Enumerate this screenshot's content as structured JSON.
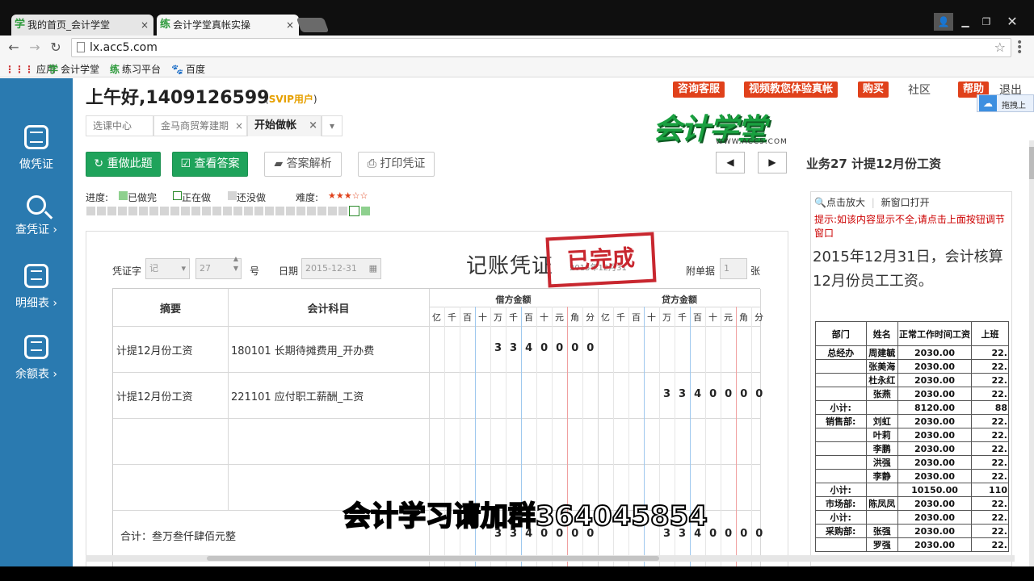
{
  "browser": {
    "tabs": [
      {
        "icon": "学",
        "label": "我的首页_会计学堂"
      },
      {
        "icon": "练",
        "label": "会计学堂真帐实操"
      }
    ],
    "close_glyph": "×",
    "url": "lx.acc5.com",
    "bookmarks": [
      {
        "icon": "⋮⋮⋮",
        "label": "应用"
      },
      {
        "icon": "学",
        "label": "会计学堂"
      },
      {
        "icon": "练",
        "label": "练习平台"
      },
      {
        "icon": "🐾",
        "label": "百度"
      }
    ]
  },
  "sidebar": [
    {
      "label": "做凭证",
      "icon": "calculator-icon"
    },
    {
      "label": "查凭证 ›",
      "icon": "search-icon"
    },
    {
      "label": "明细表 ›",
      "icon": "list-icon"
    },
    {
      "label": "余额表 ›",
      "icon": "list-icon"
    }
  ],
  "header": {
    "greeting": "上午好,1409126599",
    "svip_open": "(",
    "svip": "SVIP用户",
    "svip_close": ")",
    "links": [
      "咨询客服",
      "视频教您体验真帐",
      "购买"
    ],
    "plain_links": [
      "社区",
      "帮助",
      "退出"
    ],
    "logo": "会计学堂",
    "logo_sub": "WWW.ACC5.COM",
    "helper_text": "拖拽上"
  },
  "page_tabs": [
    {
      "label": "选课中心"
    },
    {
      "label": "金马商贸筹建期"
    },
    {
      "label": "开始做帐"
    }
  ],
  "toolbar": {
    "redo": "重做此题",
    "answer": "查看答案",
    "analysis": "答案解析",
    "print": "打印凭证",
    "prev": "◀",
    "next": "▶",
    "business_title": "业务27 计提12月份工资"
  },
  "legend": {
    "progress_label": "进度:",
    "done": "已做完",
    "doing": "正在做",
    "notdone": "还没做",
    "difficulty_label": "难度:",
    "difficulty_stars": "★★★☆☆",
    "colors": {
      "done": "#8ed08e",
      "doing": "#ffffff",
      "notdone": "#d5d5d5"
    },
    "progress_cells": 27,
    "current_index": 25
  },
  "voucher": {
    "title": "记账凭证",
    "stamp": "已完成",
    "date_display": "2015年12月31",
    "word_label": "凭证字",
    "word_value": "记",
    "number_value": "27",
    "number_suffix": "号",
    "date_label": "日期",
    "date_value": "2015-12-31",
    "attach_label": "附单据",
    "attach_value": "1",
    "attach_suffix": "张",
    "headers": {
      "summary": "摘要",
      "account": "会计科目",
      "debit": "借方金额",
      "credit": "贷方金额"
    },
    "digit_units": [
      "亿",
      "千",
      "百",
      "十",
      "万",
      "千",
      "百",
      "十",
      "元",
      "角",
      "分"
    ],
    "rows": [
      {
        "summary": "计提12月份工资",
        "account": "180101 长期待摊费用_开办费",
        "debit": "3340000",
        "credit": ""
      },
      {
        "summary": "计提12月份工资",
        "account": "221101 应付职工薪酬_工资",
        "debit": "",
        "credit": "3340000"
      },
      {
        "summary": "",
        "account": "",
        "debit": "",
        "credit": ""
      },
      {
        "summary": "",
        "account": "",
        "debit": "",
        "credit": ""
      }
    ],
    "total_label": "合计：叁万叁仟肆佰元整",
    "total_debit": "3340000",
    "total_credit": "3340000"
  },
  "right_panel": {
    "zoom": "点击放大",
    "newwin": "新窗口打开",
    "tip": "提示:如该内容显示不全,请点击上面按钮调节窗口",
    "text": "2015年12月31日，会计核算12月份员工工资。",
    "table_header": [
      "部门",
      "姓名",
      "正常工作时间工资",
      "上班"
    ],
    "table_rows": [
      [
        "总经办",
        "周建毓",
        "2030.00",
        "22."
      ],
      [
        "",
        "张美海",
        "2030.00",
        "22."
      ],
      [
        "",
        "杜永红",
        "2030.00",
        "22."
      ],
      [
        "",
        "张燕",
        "2030.00",
        "22."
      ],
      [
        "小计:",
        "",
        "8120.00",
        "88"
      ],
      [
        "销售部:",
        "刘虹",
        "2030.00",
        "22."
      ],
      [
        "",
        "叶莉",
        "2030.00",
        "22."
      ],
      [
        "",
        "李鹏",
        "2030.00",
        "22."
      ],
      [
        "",
        "洪强",
        "2030.00",
        "22."
      ],
      [
        "",
        "李静",
        "2030.00",
        "22."
      ],
      [
        "小计:",
        "",
        "10150.00",
        "110"
      ],
      [
        "市场部:",
        "陈凤凤",
        "2030.00",
        "22."
      ],
      [
        "小计:",
        "",
        "2030.00",
        "22."
      ],
      [
        "采购部:",
        "张强",
        "2030.00",
        "22."
      ],
      [
        "",
        "罗强",
        "2030.00",
        "22."
      ]
    ]
  },
  "overlay": {
    "subtitle": "会计学习请加群364045854"
  }
}
